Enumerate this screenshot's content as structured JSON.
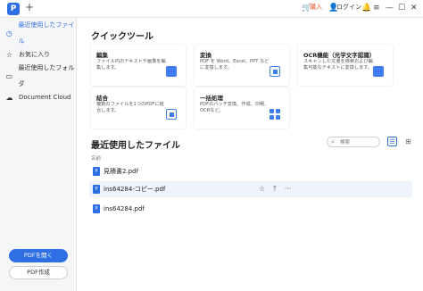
{
  "titlebar": {
    "logo_text": "P",
    "new_tab": "+",
    "buy_label": "購入",
    "login_label": "ログイン",
    "icons": [
      "cart-icon",
      "user-icon",
      "bell-icon",
      "menu-icon",
      "minimize-icon",
      "maximize-icon",
      "close-icon"
    ],
    "glyphs": {
      "cart": "🛒",
      "user": "👤",
      "bell": "🔔",
      "menu": "≡",
      "minimize": "—",
      "maximize": "☐",
      "close": "✕"
    }
  },
  "sidebar": {
    "items": [
      {
        "label": "最近使用したファイル",
        "icon": "clock-icon",
        "glyph": "◷",
        "active": true
      },
      {
        "label": "お気に入り",
        "icon": "star-icon",
        "glyph": "☆",
        "active": false
      },
      {
        "label": "最近使用したフォルダ",
        "icon": "folder-icon",
        "glyph": "▭",
        "active": false
      },
      {
        "label": "Document Cloud",
        "icon": "cloud-icon",
        "glyph": "☁",
        "active": false
      }
    ],
    "open_pdf_label": "PDFを開く",
    "create_pdf_label": "PDF作成"
  },
  "quick_tools": {
    "heading": "クイックツール",
    "cards": [
      {
        "title": "編集",
        "desc": "ファイル内のテキストや画像を編集します。",
        "icon": "edit-icon"
      },
      {
        "title": "変換",
        "desc": "PDF を Word、Excel、PPT などに変換します。",
        "icon": "convert-icon"
      },
      {
        "title": "OCR機能（光学文字認識）",
        "desc": "スキャンした文書を検索および編集可能なテキストに変換します。",
        "icon": "ocr-icon"
      },
      {
        "title": "結合",
        "desc": "複数のファイルを1つのPDFに結合します。",
        "icon": "combine-icon"
      },
      {
        "title": "一括処理",
        "desc": "PDFのバッチ変換、作成、印刷、OCRなど。",
        "icon": "batch-icon"
      }
    ]
  },
  "recent_files": {
    "heading": "最近使用したファイル",
    "search_placeholder": "検索",
    "column_name": "名前",
    "files": [
      {
        "name": "見積書2.pdf",
        "hover": false
      },
      {
        "name": "ins64284-コピー.pdf",
        "hover": true
      },
      {
        "name": "ins64284.pdf",
        "hover": false
      }
    ],
    "row_action_glyphs": {
      "star": "☆",
      "upload": "⤒",
      "more": "···"
    }
  },
  "colors": {
    "accent": "#2f6fe4",
    "buy": "#e2542b",
    "sidebar_bg": "#f5f6f8",
    "hover_row": "#eef3fc"
  }
}
